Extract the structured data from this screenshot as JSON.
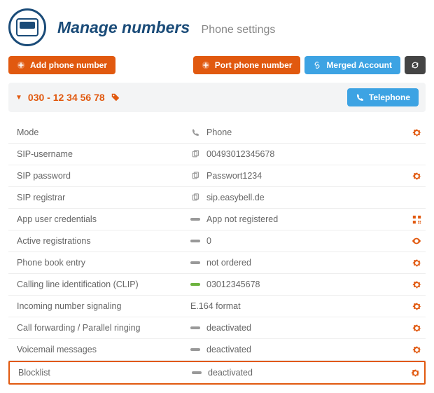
{
  "header": {
    "title": "Manage numbers",
    "subtitle": "Phone settings"
  },
  "actions": {
    "add_label": "Add phone number",
    "port_label": "Port phone number",
    "merged_label": "Merged Account"
  },
  "number_bar": {
    "phone": "030 - 12 34 56 78",
    "telephone_btn": "Telephone"
  },
  "rows": [
    {
      "key": "mode",
      "label": "Mode",
      "icon": "phone-handset",
      "value": "Phone",
      "action": "gear"
    },
    {
      "key": "sip_username",
      "label": "SIP-username",
      "icon": "copy",
      "value": "00493012345678",
      "action": null
    },
    {
      "key": "sip_password",
      "label": "SIP password",
      "icon": "copy",
      "value": "Passwort1234",
      "action": "gear"
    },
    {
      "key": "sip_registrar",
      "label": "SIP registrar",
      "icon": "copy",
      "value": "sip.easybell.de",
      "action": null
    },
    {
      "key": "app_user_cred",
      "label": "App user credentials",
      "icon": "dash",
      "value": "App not registered",
      "action": "qr"
    },
    {
      "key": "active_reg",
      "label": "Active registrations",
      "icon": "dash",
      "value": "0",
      "action": "eye"
    },
    {
      "key": "phone_book",
      "label": "Phone book entry",
      "icon": "dash",
      "value": "not ordered",
      "action": "gear"
    },
    {
      "key": "cli",
      "label": "Calling line identification (CLIP)",
      "icon": "dash-green",
      "value": "03012345678",
      "action": "gear"
    },
    {
      "key": "incoming_sig",
      "label": "Incoming number signaling",
      "icon": "none",
      "value": "E.164 format",
      "action": "gear"
    },
    {
      "key": "call_fwd",
      "label": "Call forwarding / Parallel ringing",
      "icon": "dash",
      "value": "deactivated",
      "action": "gear"
    },
    {
      "key": "voicemail",
      "label": "Voicemail messages",
      "icon": "dash",
      "value": "deactivated",
      "action": "gear"
    },
    {
      "key": "blocklist",
      "label": "Blocklist",
      "icon": "dash",
      "value": "deactivated",
      "action": "gear",
      "highlight": true
    }
  ]
}
